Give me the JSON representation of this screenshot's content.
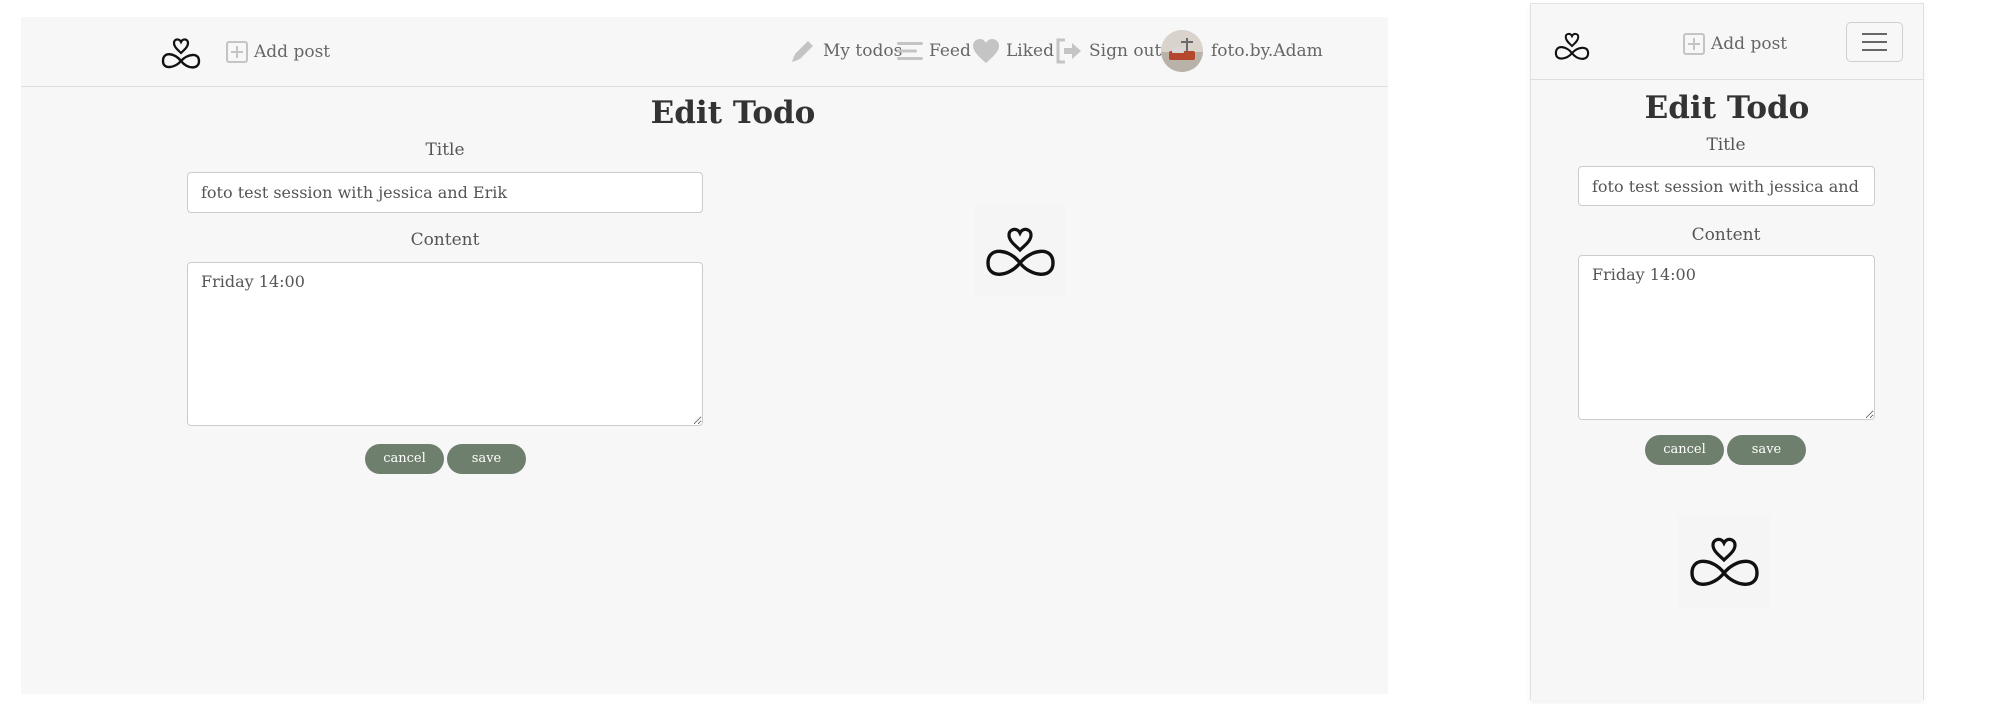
{
  "nav": {
    "add_post": "Add post",
    "my_todos": "My todos",
    "feed": "Feed",
    "liked": "Liked",
    "sign_out": "Sign out",
    "username": "foto.by.Adam"
  },
  "page": {
    "heading": "Edit Todo",
    "title_label": "Title",
    "content_label": "Content",
    "title_value": "foto test session with jessica and Erik",
    "content_value": "Friday 14:00",
    "cancel_label": "cancel",
    "save_label": "save"
  },
  "icons": {
    "logo": "infinity-heart-icon",
    "add": "plus-square-icon",
    "my_todos": "pencil-icon",
    "feed": "list-lines-icon",
    "liked": "heart-icon",
    "sign_out": "sign-out-icon",
    "menu": "hamburger-menu-icon"
  },
  "colors": {
    "button_bg": "#6f7f6e",
    "page_bg": "#f7f7f7",
    "icon_gray": "#c4c4c4"
  }
}
